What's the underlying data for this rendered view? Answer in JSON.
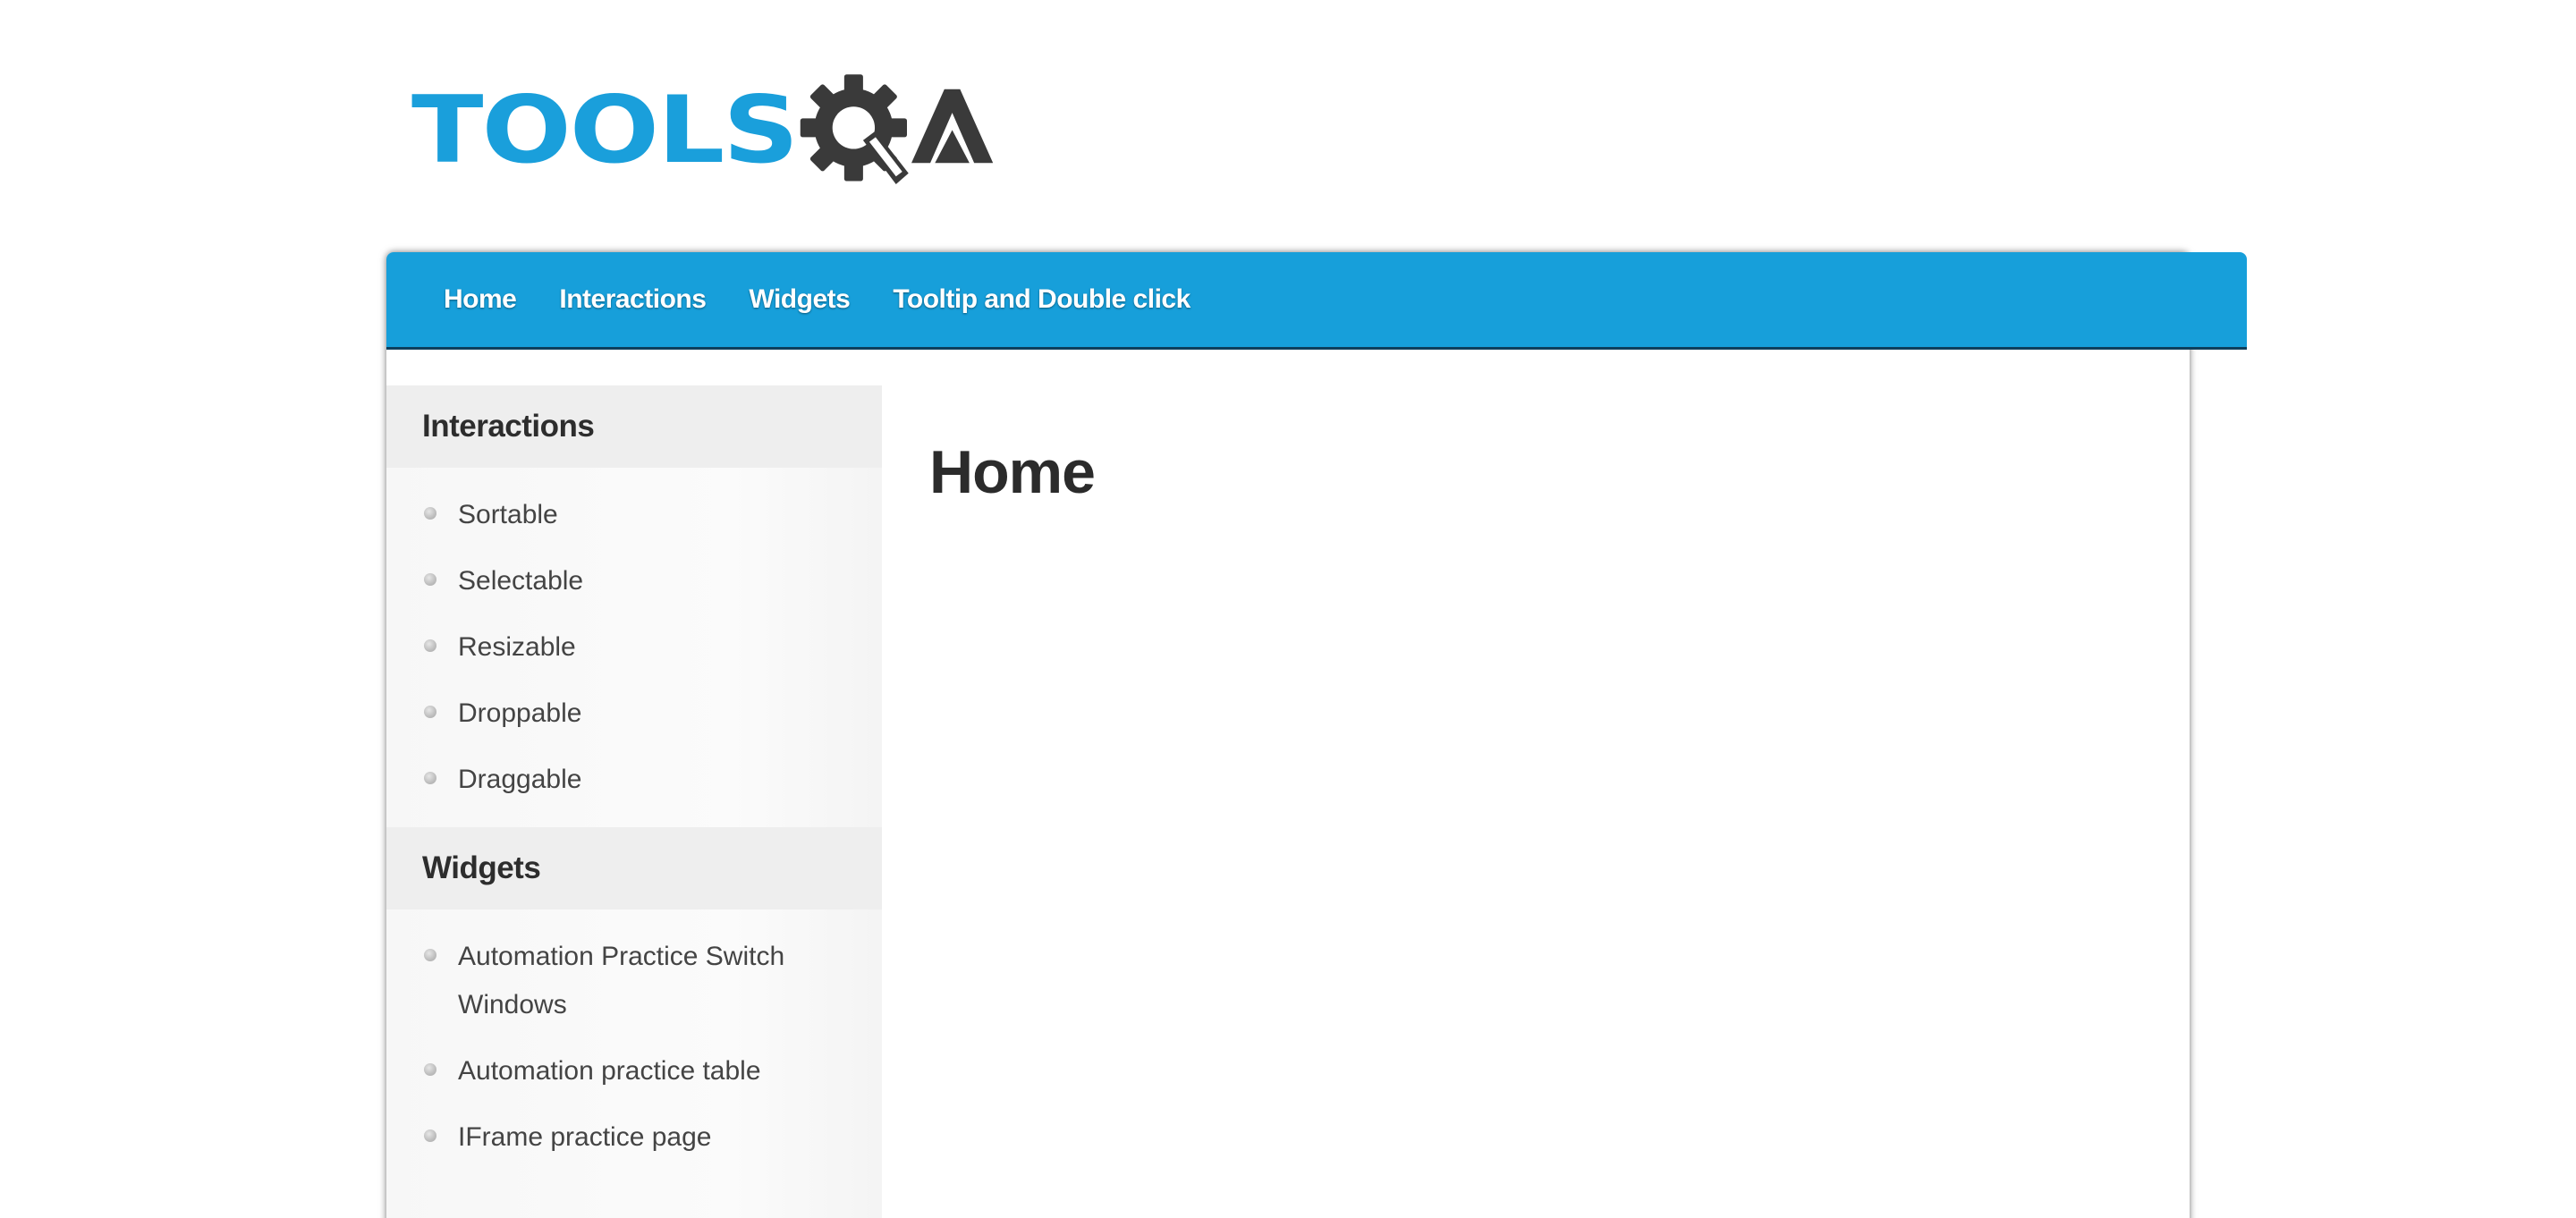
{
  "logo": {
    "text_tools": "TOOLS",
    "text_q_icon": "gear-magnifier-icon",
    "text_a": "A",
    "color_primary": "#1a9fdb",
    "color_secondary": "#3a3a3a"
  },
  "nav": {
    "items": [
      {
        "label": "Home"
      },
      {
        "label": "Interactions"
      },
      {
        "label": "Widgets"
      },
      {
        "label": "Tooltip and Double click"
      }
    ],
    "background": "#179fda"
  },
  "sidebar": {
    "sections": [
      {
        "heading": "Interactions",
        "items": [
          {
            "label": "Sortable"
          },
          {
            "label": "Selectable"
          },
          {
            "label": "Resizable"
          },
          {
            "label": "Droppable"
          },
          {
            "label": "Draggable"
          }
        ]
      },
      {
        "heading": "Widgets",
        "items": [
          {
            "label": "Automation Practice Switch Windows"
          },
          {
            "label": "Automation practice table"
          },
          {
            "label": "IFrame practice page"
          }
        ]
      }
    ]
  },
  "main": {
    "title": "Home"
  }
}
